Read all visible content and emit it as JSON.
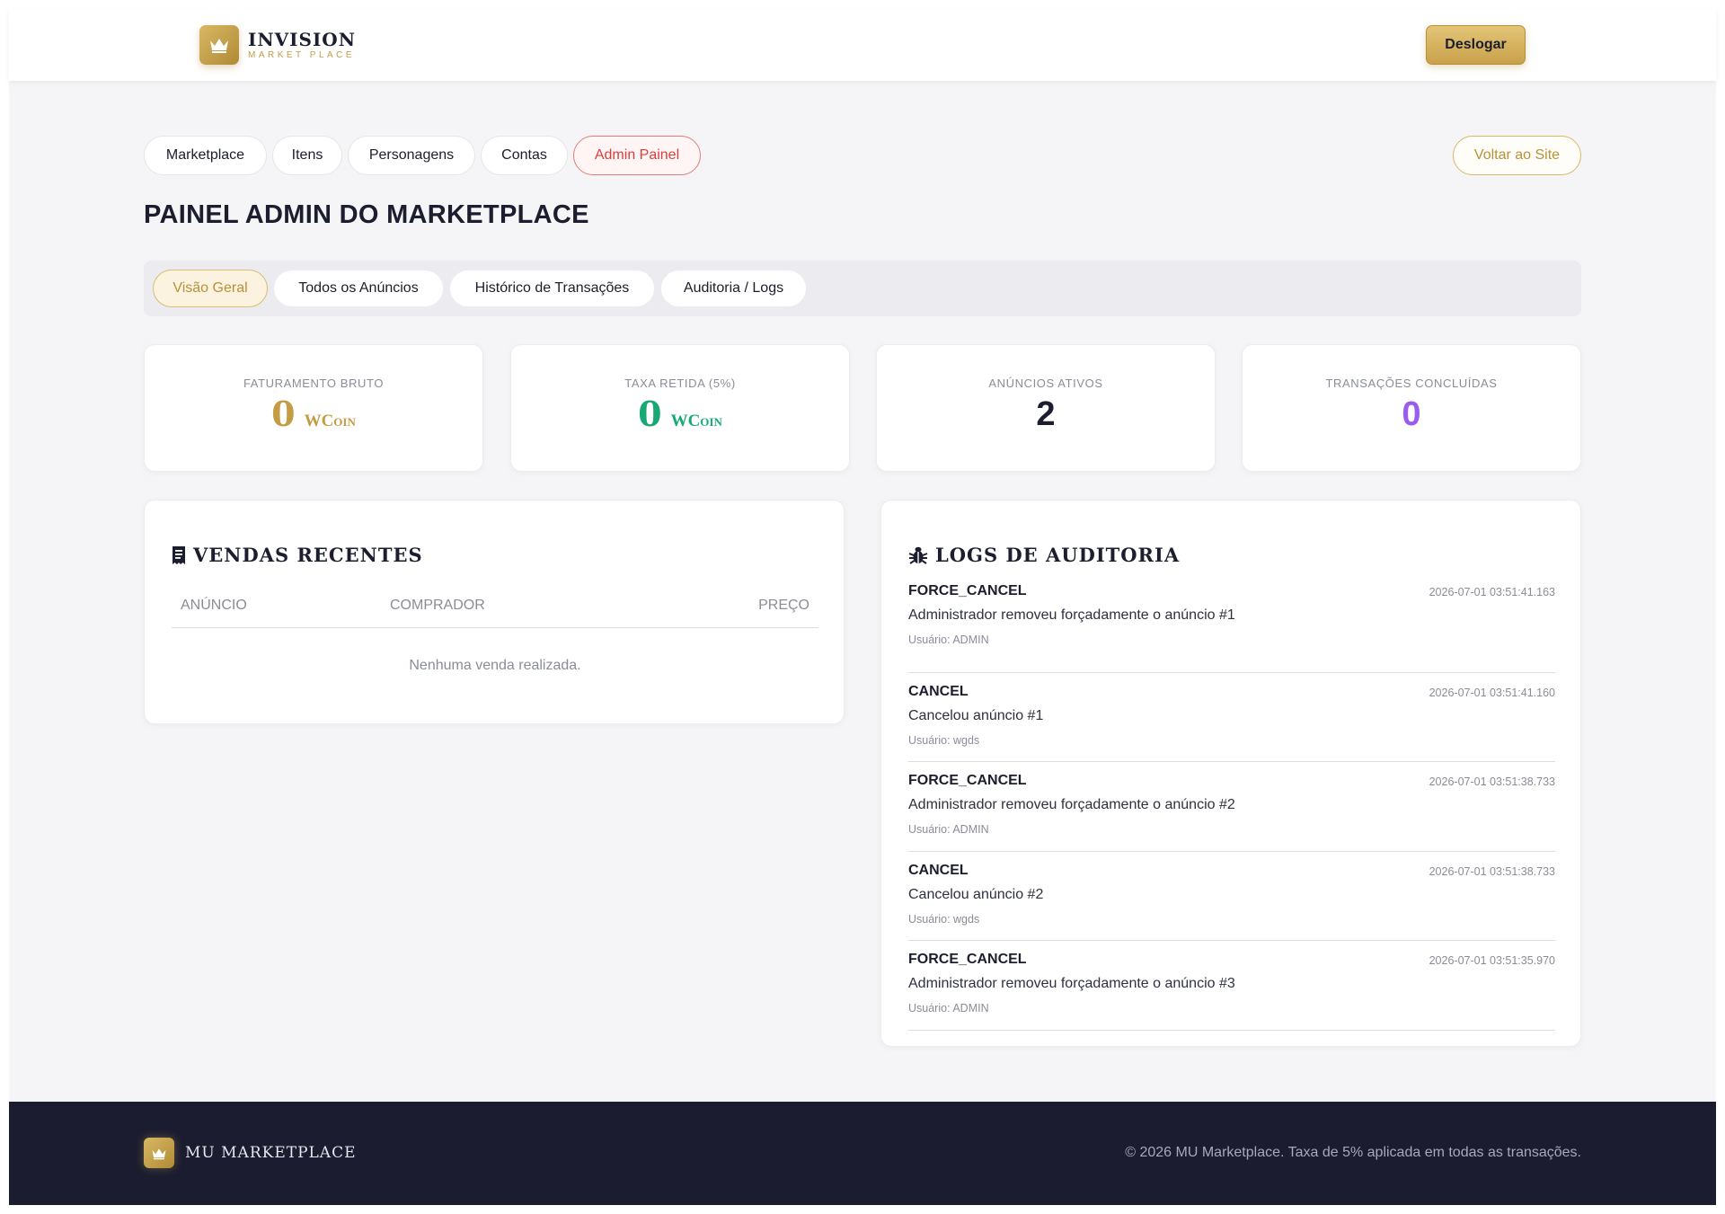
{
  "header": {
    "brand_name": "INVISION",
    "brand_sub": "MARKET PLACE",
    "logout_label": "Deslogar"
  },
  "nav": {
    "items": [
      "Marketplace",
      "Itens",
      "Personagens",
      "Contas",
      "Admin Painel"
    ],
    "back_label": "Voltar ao Site"
  },
  "page": {
    "title": "PAINEL ADMIN DO MARKETPLACE"
  },
  "tabs": {
    "items": [
      "Visão Geral",
      "Todos os Anúncios",
      "Histórico de Transações",
      "Auditoria / Logs"
    ],
    "active": "Visão Geral"
  },
  "stats": [
    {
      "label": "FATURAMENTO BRUTO",
      "value": "0",
      "unit": "WCoin",
      "color": "#c39c43"
    },
    {
      "label": "TAXA RETIDA (5%)",
      "value": "0",
      "unit": "WCoin",
      "color": "#18a874"
    },
    {
      "label": "ANÚNCIOS ATIVOS",
      "value": "2",
      "unit": "",
      "color": "#1c1d2e"
    },
    {
      "label": "TRANSAÇÕES CONCLUÍDAS",
      "value": "0",
      "unit": "",
      "color": "#9a5cf0"
    }
  ],
  "sales": {
    "title": "VENDAS RECENTES",
    "columns": [
      "ANÚNCIO",
      "COMPRADOR",
      "PREÇO"
    ],
    "empty_text": "Nenhuma venda realizada."
  },
  "logs": {
    "title": "LOGS DE AUDITORIA",
    "items": [
      {
        "action": "FORCE_CANCEL",
        "time": "2026-07-01 03:51:41.163",
        "desc": "Administrador removeu forçadamente o anúncio #1",
        "user": "Usuário: ADMIN"
      },
      {
        "action": "CANCEL",
        "time": "2026-07-01 03:51:41.160",
        "desc": "Cancelou anúncio #1",
        "user": "Usuário: wgds"
      },
      {
        "action": "FORCE_CANCEL",
        "time": "2026-07-01 03:51:38.733",
        "desc": "Administrador removeu forçadamente o anúncio #2",
        "user": "Usuário: ADMIN"
      },
      {
        "action": "CANCEL",
        "time": "2026-07-01 03:51:38.733",
        "desc": "Cancelou anúncio #2",
        "user": "Usuário: wgds"
      },
      {
        "action": "FORCE_CANCEL",
        "time": "2026-07-01 03:51:35.970",
        "desc": "Administrador removeu forçadamente o anúncio #3",
        "user": "Usuário: ADMIN"
      }
    ]
  },
  "footer": {
    "brand_name": "MU MARKETPLACE",
    "copyright": "© 2026 MU Marketplace. Taxa de 5% aplicada em todas as transações."
  },
  "icons": {
    "logo": "crown-icon",
    "sales": "receipt-icon",
    "logs": "bug-icon"
  },
  "colors": {
    "accent_gold": "#c39c43",
    "admin_red": "#dd3d3d",
    "footer_bg": "#1b1c2f"
  }
}
